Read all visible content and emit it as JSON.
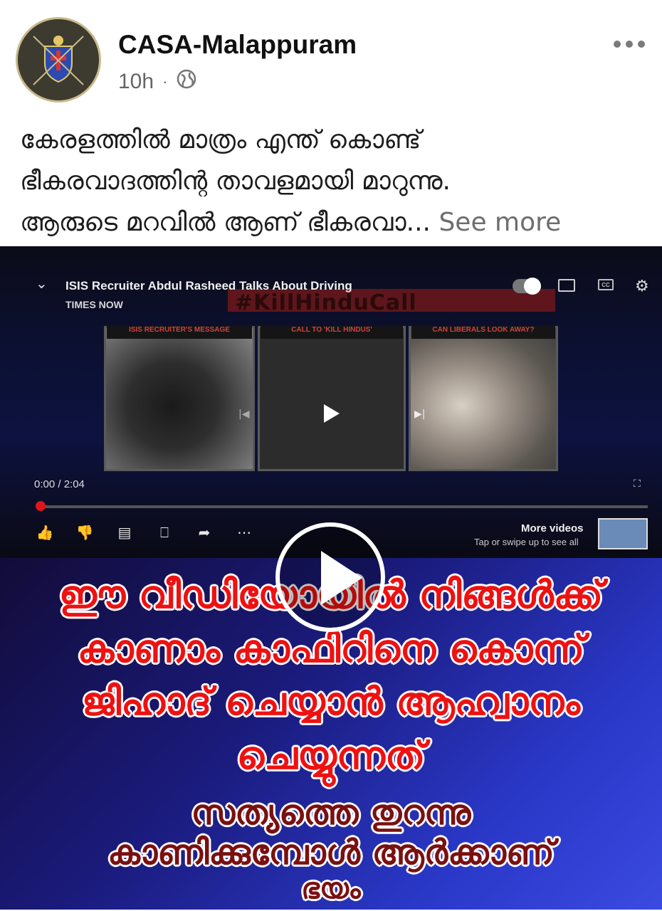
{
  "post": {
    "page_name": "CASA-Malappuram",
    "time": "10h",
    "dot": "·",
    "text_line1": "കേരളത്തിൽ മാത്രം എന്ത് കൊണ്ട്",
    "text_line2": "ഭീകരവാദത്തിന്റ താവളമായി മാറുന്നു.",
    "text_line3": "ആരുടെ മറവിൽ ആണ് ഭീകരവാ...",
    "see_more": "See more"
  },
  "video": {
    "title": "ISIS Recruiter Abdul Rasheed Talks About Driving",
    "channel": "TIMES NOW",
    "banner_text": "#KillHinduCall",
    "panel_labels": [
      "ISIS RECRUITER'S MESSAGE",
      "CALL TO 'KILL HINDUS'",
      "CAN LIBERALS LOOK AWAY?"
    ],
    "time": "0:00 / 2:04",
    "more_videos": "More videos",
    "more_videos_sub": "Tap or swipe up to see all",
    "progress": 0,
    "overlay_lines": [
      "ഈ വീഡിയോയിൽ നിങ്ങൾക്ക്",
      "കാണാം കാഫിറിനെ കൊന്ന്",
      "ജിഹാദ് ചെയ്യാൻ ആഹ്വാനം",
      "ചെയ്യുന്നത്"
    ],
    "overlay_lines2": [
      "സത്യത്തെ തുറന്നു",
      "കാണിക്കുമ്പോൾ ആർക്കാണ്",
      "ഭയം"
    ]
  },
  "colors": {
    "accent_red": "#ee1111",
    "progress_red": "#e0141b"
  }
}
